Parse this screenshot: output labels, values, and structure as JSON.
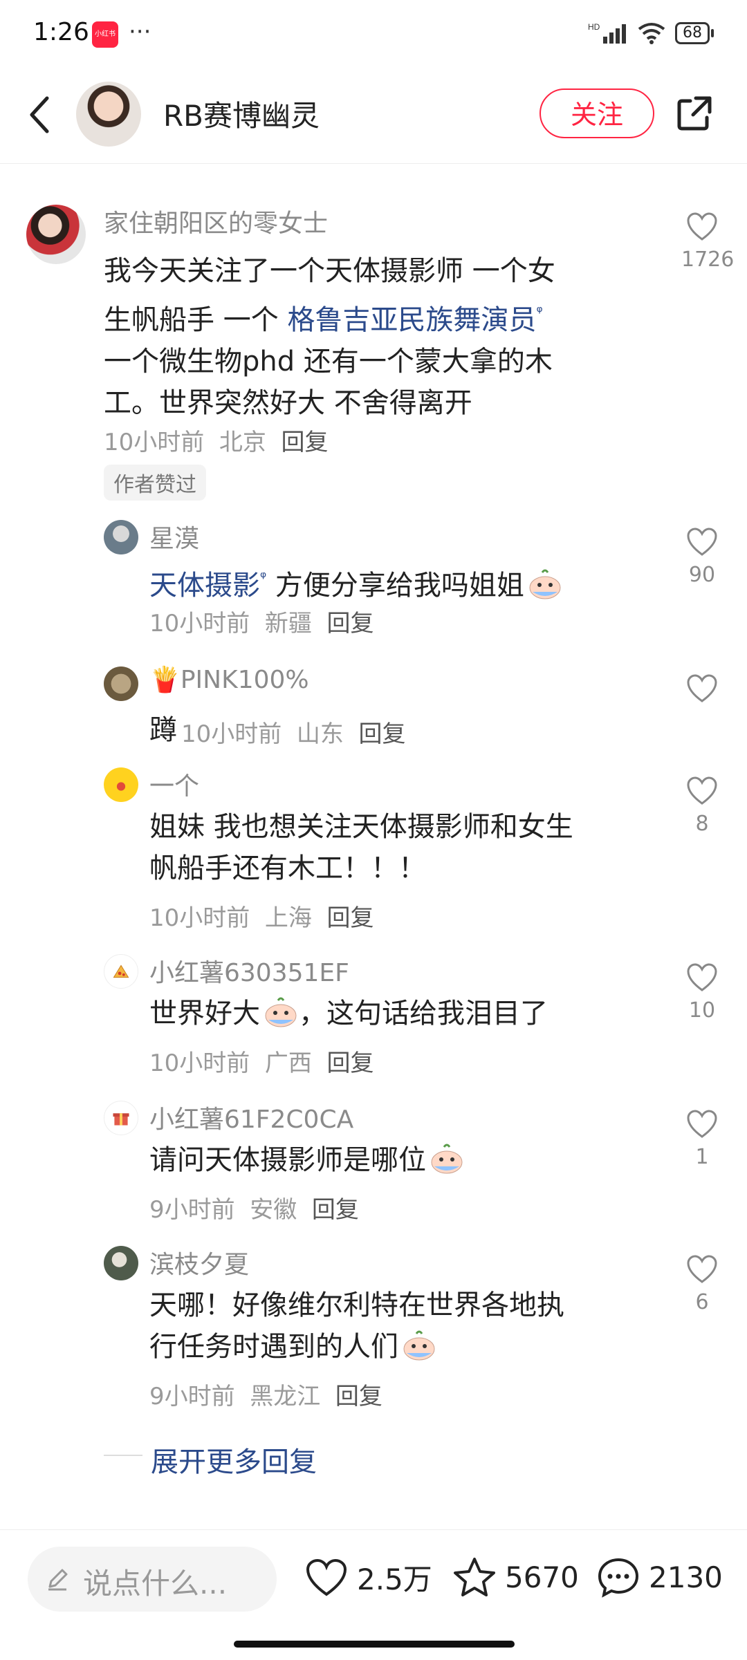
{
  "status": {
    "time": "1:26",
    "app_badge": "小红书",
    "dots": "···",
    "battery": "68",
    "net": "HD"
  },
  "header": {
    "name": "RB赛博幽灵",
    "follow": "关注"
  },
  "main_comment": {
    "user": "家住朝阳区的零女士",
    "text_a": "我今天关注了一个天体摄影师 一个女",
    "text_b1": "生帆船手 一个 ",
    "text_b_link": "格鲁吉亚民族舞演员",
    "text_c": "一个微生物phd 还有一个蒙大拿的木",
    "text_d": "工。世界突然好大 不舍得离开",
    "time": "10小时前",
    "location": "北京",
    "reply": "回复",
    "likes": "1726",
    "tag": "作者赞过"
  },
  "replies": [
    {
      "user": "星漠",
      "text_link": "天体摄影",
      "text": " 方便分享给我吗姐姐",
      "time": "10小时前",
      "location": "新疆",
      "reply": "回复",
      "likes": "90"
    },
    {
      "user": "🍟PINK100%",
      "text": "蹲",
      "time": "10小时前",
      "location": "山东",
      "reply": "回复",
      "likes": ""
    },
    {
      "user": "一个",
      "text_a": "姐妹 我也想关注天体摄影师和女生",
      "text_b": "帆船手还有木工！！！",
      "time": "10小时前",
      "location": "上海",
      "reply": "回复",
      "likes": "8"
    },
    {
      "user": "小红薯630351EF",
      "text_a": "世界好大",
      "text_b": "，这句话给我泪目了",
      "time": "10小时前",
      "location": "广西",
      "reply": "回复",
      "likes": "10"
    },
    {
      "user": "小红薯61F2C0CA",
      "text": "请问天体摄影师是哪位",
      "time": "9小时前",
      "location": "安徽",
      "reply": "回复",
      "likes": "1"
    },
    {
      "user": "滨枝夕夏",
      "text_a": "天哪！好像维尔利特在世界各地执",
      "text_b": "行任务时遇到的人们",
      "time": "9小时前",
      "location": "黑龙江",
      "reply": "回复",
      "likes": "6"
    }
  ],
  "more_replies": "展开更多回复",
  "bottom": {
    "placeholder": "说点什么...",
    "likes": "2.5万",
    "stars": "5670",
    "comments": "2130"
  },
  "colors": {
    "brand": "#ff2442",
    "link": "#2b4a8b"
  }
}
